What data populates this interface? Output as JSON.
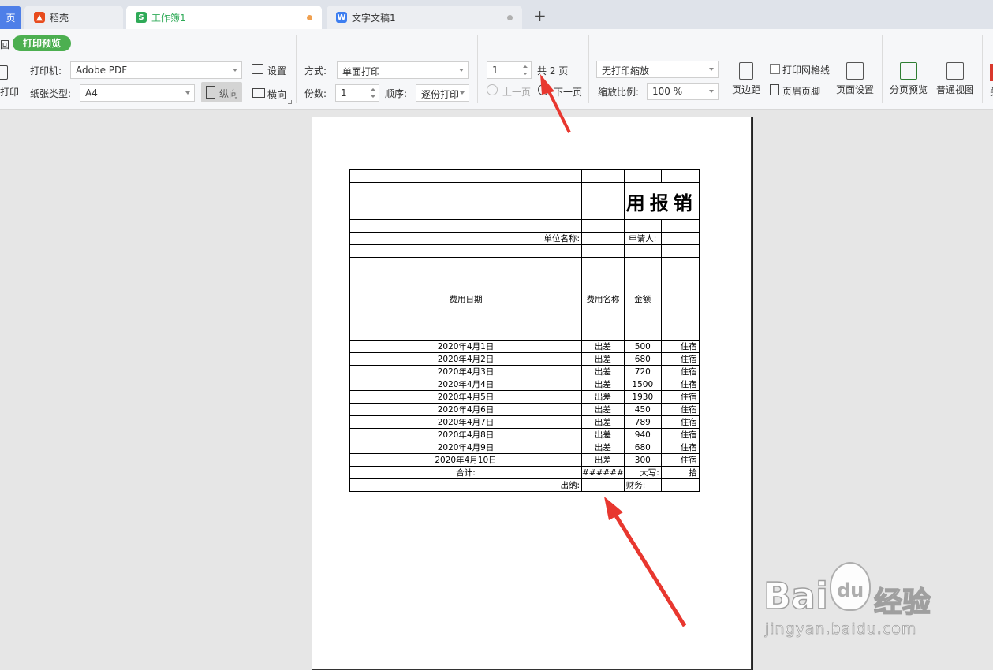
{
  "tabs": [
    {
      "label": "页",
      "active": true,
      "color": "#4e7fe8"
    },
    {
      "label": "稻壳",
      "icon": "docer-icon",
      "color": "#e84c1e"
    },
    {
      "label": "工作簿1",
      "icon": "S",
      "color": "#2eaa57",
      "modified": true
    },
    {
      "label": "文字文稿1",
      "icon": "W",
      "color": "#3d7ef0"
    }
  ],
  "new_tab": "+",
  "toolbar": {
    "back": "回",
    "mode_badge": "打印预览",
    "print_label": "打印",
    "printer_label": "打印机:",
    "printer_value": "Adobe PDF",
    "settings": "设置",
    "paper_label": "纸张类型:",
    "paper_value": "A4",
    "portrait": "纵向",
    "landscape": "横向",
    "method_label": "方式:",
    "method_value": "单面打印",
    "copies_label": "份数:",
    "copies_value": "1",
    "order_label": "顺序:",
    "order_value": "逐份打印",
    "page_value": "1",
    "total_pages": "共 2 页",
    "prev_page": "上一页",
    "next_page": "下一页",
    "scale_mode": "无打印缩放",
    "zoom_label": "缩放比例:",
    "zoom_value": "100 %",
    "margins": "页边距",
    "print_gridlines": "打印网格线",
    "header_footer": "页眉页脚",
    "page_setup": "页面设置",
    "page_break_preview": "分页预览",
    "normal_view": "普通视图",
    "close_partial": "关"
  },
  "sheet": {
    "title": "用报销",
    "unit_name": "单位名称:",
    "applicant": "申请人:",
    "col_date": "费用日期",
    "col_name": "费用名称",
    "col_amount": "金额",
    "rows": [
      {
        "date": "2020年4月1日",
        "name": "出差",
        "amount": "500",
        "extra": "住宿"
      },
      {
        "date": "2020年4月2日",
        "name": "出差",
        "amount": "680",
        "extra": "住宿"
      },
      {
        "date": "2020年4月3日",
        "name": "出差",
        "amount": "720",
        "extra": "住宿"
      },
      {
        "date": "2020年4月4日",
        "name": "出差",
        "amount": "1500",
        "extra": "住宿"
      },
      {
        "date": "2020年4月5日",
        "name": "出差",
        "amount": "1930",
        "extra": "住宿"
      },
      {
        "date": "2020年4月6日",
        "name": "出差",
        "amount": "450",
        "extra": "住宿"
      },
      {
        "date": "2020年4月7日",
        "name": "出差",
        "amount": "789",
        "extra": "住宿"
      },
      {
        "date": "2020年4月8日",
        "name": "出差",
        "amount": "940",
        "extra": "住宿"
      },
      {
        "date": "2020年4月9日",
        "name": "出差",
        "amount": "680",
        "extra": "住宿"
      },
      {
        "date": "2020年4月10日",
        "name": "出差",
        "amount": "300",
        "extra": "住宿"
      }
    ],
    "total_label": "合计:",
    "total_value": "######",
    "uppercase_label": "大写:",
    "uppercase_value": "拾",
    "cashier": "出纳:",
    "finance": "财务:"
  },
  "watermark": {
    "brand": "Bai",
    "brand2": "du",
    "jingyan": "经验",
    "url": "jingyan.baidu.com"
  },
  "colors": {
    "accent_green": "#4caf50",
    "arrow_red": "#e8372f"
  }
}
